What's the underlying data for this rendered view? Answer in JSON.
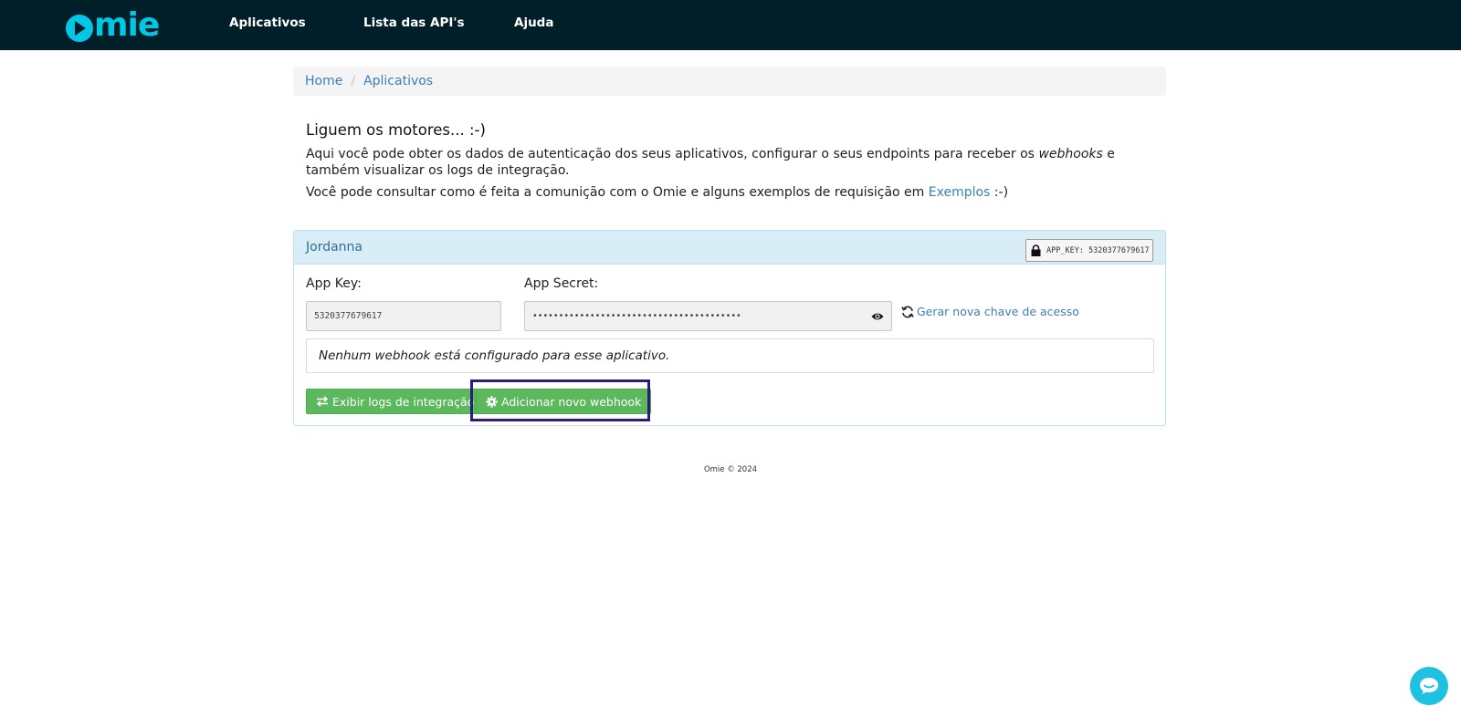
{
  "nav": {
    "logo_text": "mie",
    "items": [
      {
        "label": "Aplicativos"
      },
      {
        "label": "Lista das API's"
      },
      {
        "label": "Ajuda"
      }
    ]
  },
  "breadcrumb": {
    "items": [
      "Home",
      "Aplicativos"
    ],
    "separator": "/"
  },
  "intro": {
    "title": "Liguem os motores... :-)",
    "p1_a": "Aqui você pode obter os dados de autenticação dos seus aplicativos, configurar o seus endpoints para receber os ",
    "p1_em": "webhooks",
    "p1_b": " e também visualizar os logs de integração.",
    "p2_a": "Você pode consultar como é feita a comunição com o Omie e alguns exemplos de requisição em ",
    "p2_link": "Exemplos",
    "p2_b": " :-)"
  },
  "app": {
    "name": "Jordanna",
    "badge": "APP_KEY: 5320377679617",
    "app_key_label": "App Key:",
    "app_key_value": "5320377679617",
    "app_secret_label": "App Secret:",
    "app_secret_value": "••••••••••••••••••••••••••••••••••••••••",
    "regen_label": "Gerar nova chave de acesso",
    "no_webhook_text": "Nenhum webhook está configurado para esse aplicativo.",
    "btn_logs": "Exibir logs de integração",
    "btn_webhook": "Adicionar novo webhook"
  },
  "footer": {
    "text": "Omie © 2024"
  },
  "colors": {
    "topbar": "#001f28",
    "brand": "#00c8e4",
    "link": "#3c7fb4",
    "button": "#5cb85c",
    "highlight": "#2d1b80"
  },
  "icons": {
    "lock": "lock-icon",
    "eye": "eye-icon",
    "refresh": "refresh-icon",
    "exchange": "exchange-icon",
    "gear": "gear-icon",
    "chat": "chat-icon"
  }
}
